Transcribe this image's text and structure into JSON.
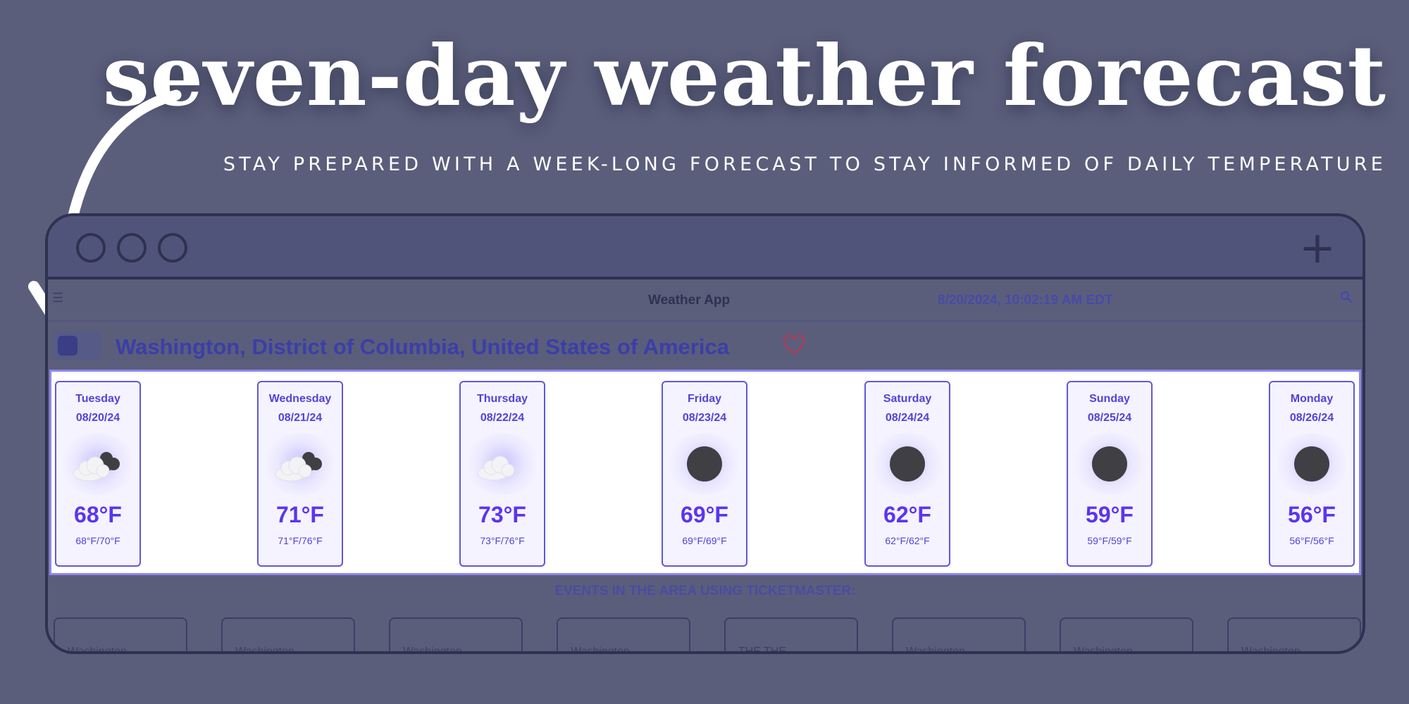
{
  "poster": {
    "headline": "seven-day weather forecast",
    "subline": "STAY PREPARED WITH A WEEK-LONG FORECAST TO STAY INFORMED OF DAILY TEMPERATURE"
  },
  "browser": {
    "new_tab_label": "+"
  },
  "app": {
    "title": "Weather App",
    "datetime": "8/20/2024, 10:02:19 AM EDT",
    "location": "Washington, District of Columbia, United States of America"
  },
  "forecast": {
    "days": [
      {
        "day": "Tuesday",
        "date": "08/20/24",
        "icon": "partly-cloudy-night-icon",
        "temp": "68°F",
        "range": "68°F/70°F"
      },
      {
        "day": "Wednesday",
        "date": "08/21/24",
        "icon": "partly-cloudy-night-icon",
        "temp": "71°F",
        "range": "71°F/76°F"
      },
      {
        "day": "Thursday",
        "date": "08/22/24",
        "icon": "cloud-icon",
        "temp": "73°F",
        "range": "73°F/76°F"
      },
      {
        "day": "Friday",
        "date": "08/23/24",
        "icon": "moon-icon",
        "temp": "69°F",
        "range": "69°F/69°F"
      },
      {
        "day": "Saturday",
        "date": "08/24/24",
        "icon": "moon-icon",
        "temp": "62°F",
        "range": "62°F/62°F"
      },
      {
        "day": "Sunday",
        "date": "08/25/24",
        "icon": "moon-icon",
        "temp": "59°F",
        "range": "59°F/59°F"
      },
      {
        "day": "Monday",
        "date": "08/26/24",
        "icon": "moon-icon",
        "temp": "56°F",
        "range": "56°F/56°F"
      }
    ]
  },
  "events": {
    "title": "EVENTS IN THE AREA USING TICKETMASTER:",
    "cards": [
      "Washington",
      "Washington",
      "Washington",
      "Washington",
      "THE THE",
      "Washington",
      "Washington",
      "Washington"
    ]
  },
  "colors": {
    "background": "#5a5e7b",
    "accent": "#5a35f0",
    "frame": "#2e3150"
  }
}
